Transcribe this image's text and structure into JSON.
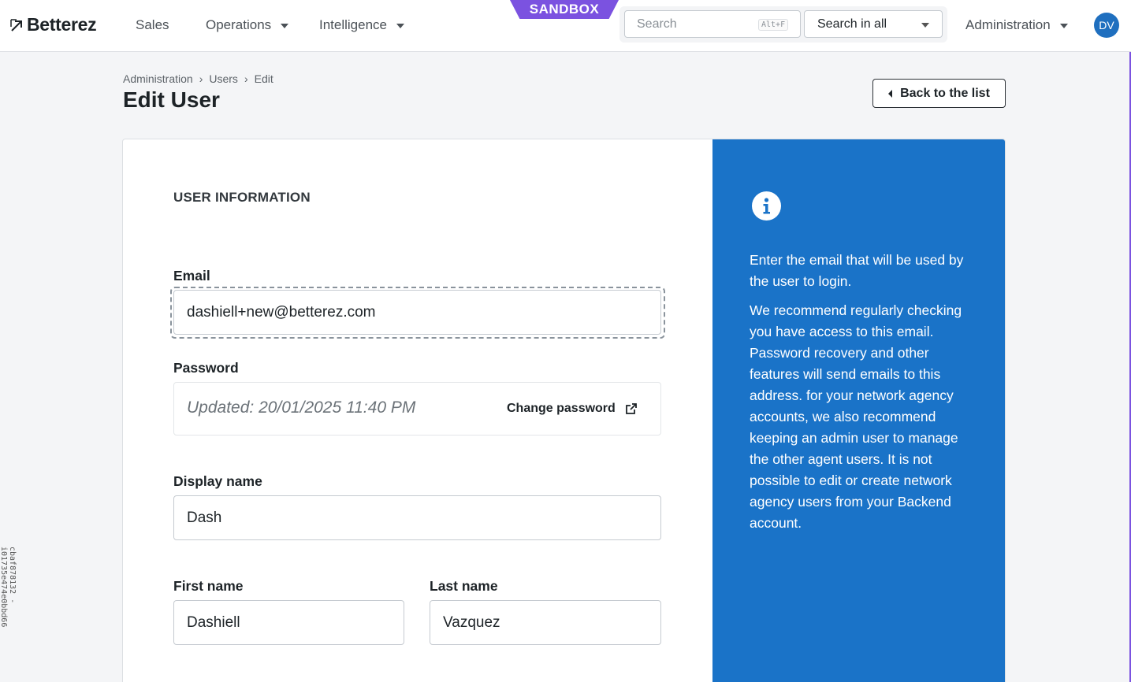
{
  "app": {
    "logo_text": "Betterez",
    "sandbox_label": "SANDBOX",
    "user_initials": "DV"
  },
  "nav": {
    "items": [
      {
        "label": "Sales"
      },
      {
        "label": "Operations"
      },
      {
        "label": "Intelligence"
      },
      {
        "label": "Administration"
      }
    ]
  },
  "search": {
    "placeholder": "Search",
    "shortcut": "Alt+F",
    "scope": "Search in all"
  },
  "breadcrumb": [
    "Administration",
    "›",
    "Users",
    "›",
    "Edit"
  ],
  "page": {
    "title": "Edit User",
    "back_label": "Back to the list"
  },
  "form": {
    "section_title": "USER INFORMATION",
    "email_label": "Email",
    "email_value": "dashiell+new@betterez.com",
    "password_label": "Password",
    "password_updated": "Updated: 20/01/2025 11:40 PM",
    "change_password_label": "Change password",
    "display_name_label": "Display name",
    "display_name_value": "Dash",
    "first_name_label": "First name",
    "first_name_value": "Dashiell",
    "last_name_label": "Last name",
    "last_name_value": "Vazquez"
  },
  "info": {
    "paragraph1": "Enter the email that will be used by the user to login.",
    "paragraph2": "We recommend regularly checking you have access to this email. Password recovery and other features will send emails to this address. for your network agency accounts, we also recommend keeping an admin user to manage the other agent users. It is not possible to edit or create network agency users from your Backend account."
  },
  "side_id": "cbaf878132 - i01735e474e0bbd66",
  "colors": {
    "accent": "#1a73c8",
    "sandbox": "#7b52e0"
  }
}
